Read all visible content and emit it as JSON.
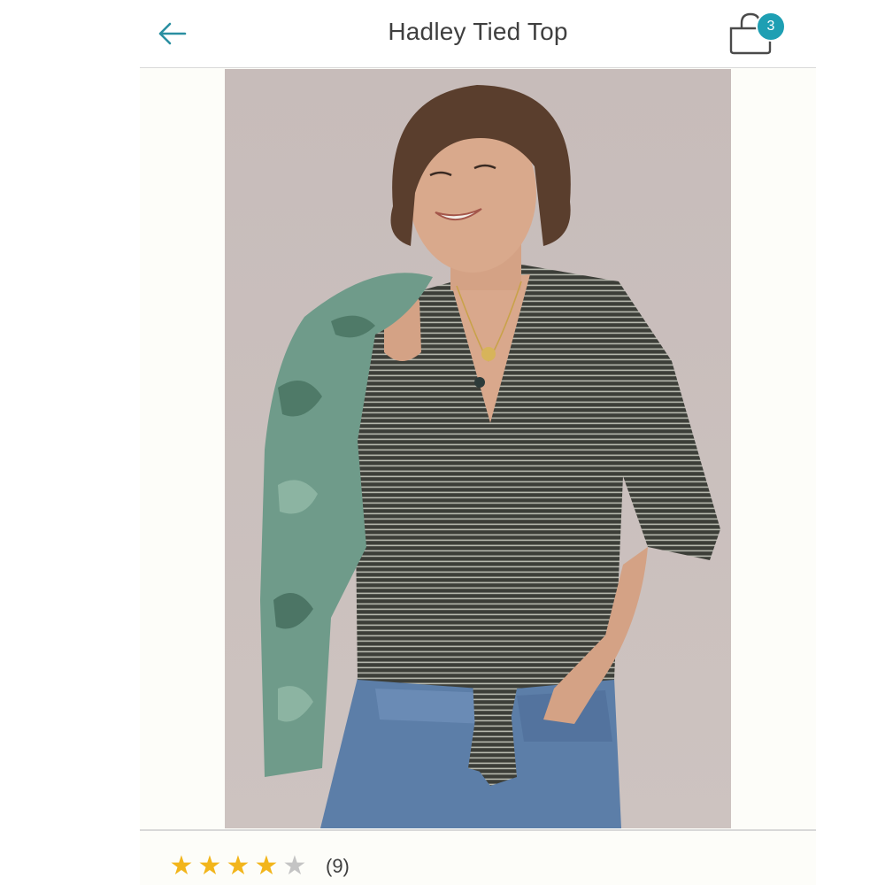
{
  "header": {
    "title": "Hadley Tied Top",
    "back_icon": "arrow-left-icon",
    "bag_icon": "shopping-bag-icon",
    "bag_count": "3"
  },
  "product_image": {
    "alt": "Hadley Tied Top"
  },
  "rating": {
    "stars": 4,
    "max_stars": 5,
    "review_count": "(9)"
  },
  "colors": {
    "accent": "#1e9fb3",
    "star_filled": "#f2b51b",
    "star_empty": "#c4c4c4",
    "text": "#3f3f3f"
  }
}
